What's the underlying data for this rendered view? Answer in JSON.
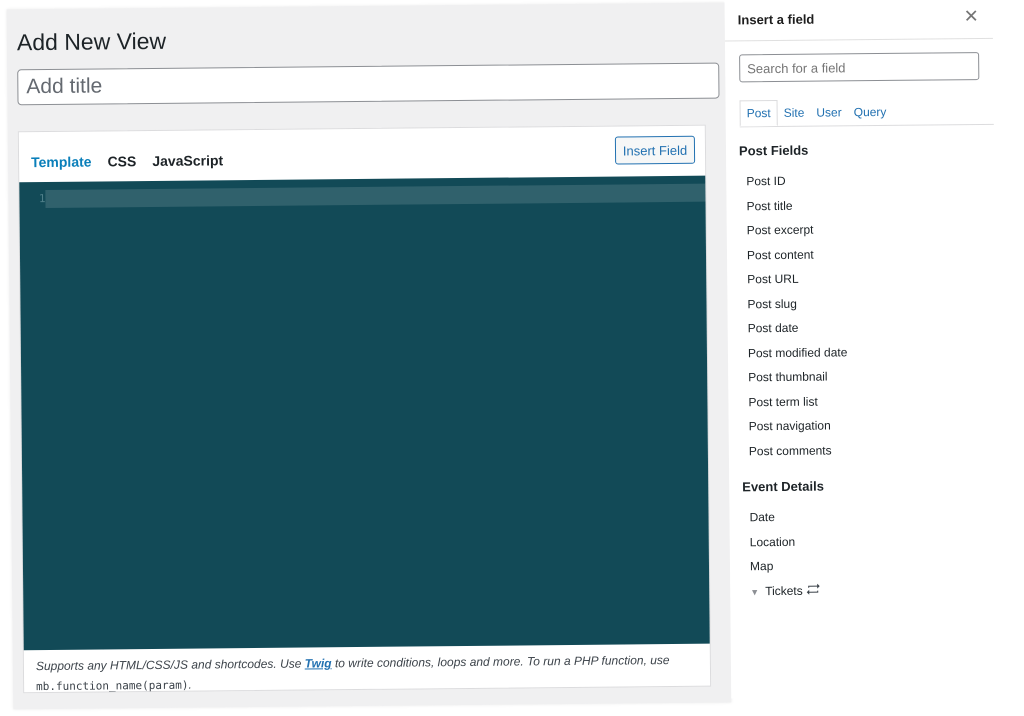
{
  "main": {
    "page_title": "Add New View",
    "title_placeholder": "Add title",
    "tabs": [
      {
        "label": "Template",
        "active": true
      },
      {
        "label": "CSS",
        "active": false
      },
      {
        "label": "JavaScript",
        "active": false
      }
    ],
    "insert_field_label": "Insert Field",
    "editor": {
      "line_number": "1",
      "background": "#124a57"
    },
    "help": {
      "before_link": "Supports any HTML/CSS/JS and shortcodes. Use ",
      "link": "Twig",
      "after_link": " to write conditions, loops and more. To run a PHP function, use ",
      "code": "mb.function_name(param)",
      "end": "."
    }
  },
  "panel": {
    "title": "Insert a field",
    "close_icon": "close-icon",
    "search_placeholder": "Search for a field",
    "tabs": [
      {
        "label": "Post",
        "active": true
      },
      {
        "label": "Site",
        "active": false
      },
      {
        "label": "User",
        "active": false
      },
      {
        "label": "Query",
        "active": false
      }
    ],
    "sections": [
      {
        "heading": "Post Fields",
        "items": [
          "Post ID",
          "Post title",
          "Post excerpt",
          "Post content",
          "Post URL",
          "Post slug",
          "Post date",
          "Post modified date",
          "Post thumbnail",
          "Post term list",
          "Post navigation",
          "Post comments"
        ]
      },
      {
        "heading": "Event Details",
        "items": [
          "Date",
          "Location",
          "Map",
          "Tickets"
        ]
      }
    ]
  },
  "colors": {
    "accent": "#2271b1",
    "active_tab": "#0a7fba"
  }
}
